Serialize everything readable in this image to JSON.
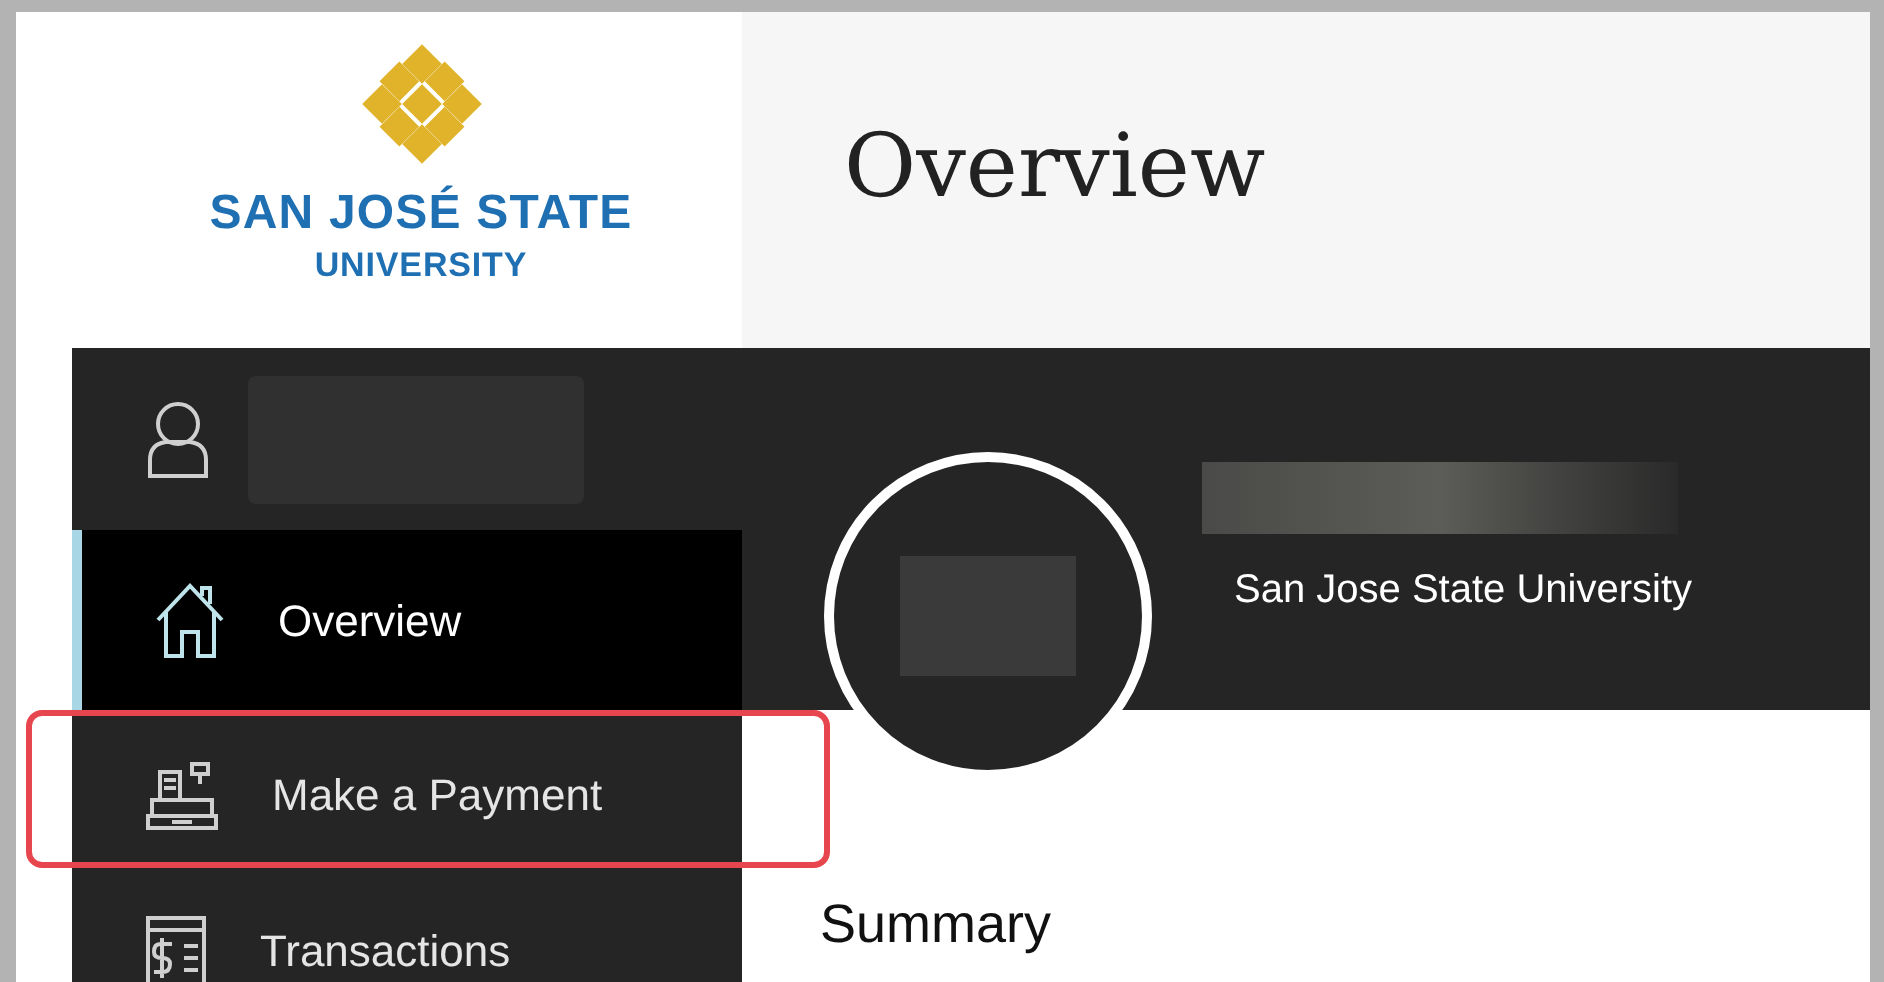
{
  "logo": {
    "line_1": "SAN JOSÉ STATE",
    "line_2": "UNIVERSITY"
  },
  "page_title": "Overview",
  "sidebar": {
    "items": [
      {
        "kind": "home",
        "label": "Overview",
        "selected": true,
        "highlighted": false
      },
      {
        "kind": "register",
        "label": "Make a Payment",
        "selected": false,
        "highlighted": true
      },
      {
        "kind": "statement",
        "label": "Transactions",
        "selected": false,
        "highlighted": false
      }
    ]
  },
  "profile": {
    "organization": "San Jose State University"
  },
  "section_heading": "Summary"
}
